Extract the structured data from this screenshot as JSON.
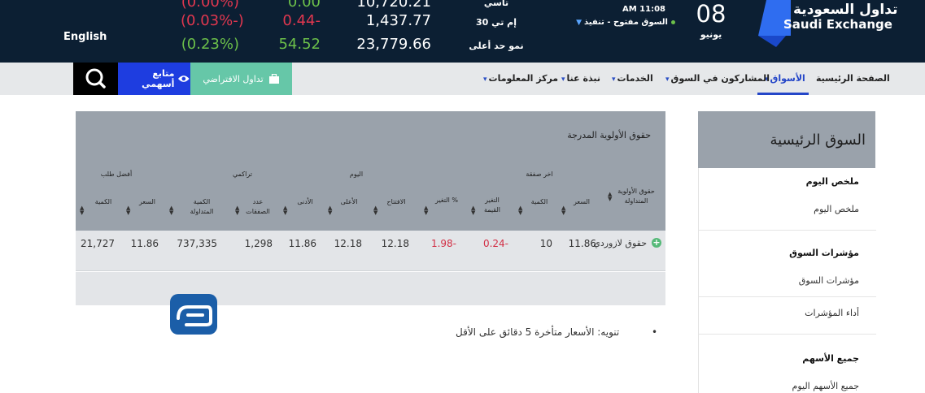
{
  "header": {
    "language_label": "English",
    "ticker": [
      {
        "pct": "(0.03%-)",
        "change": "0.44-",
        "value": "1,437.77",
        "label": "إم تي 30",
        "dir": "down"
      },
      {
        "pct": "(0.23%)",
        "change": "54.52",
        "value": "23,779.66",
        "label": "نمو حد أعلى",
        "dir": "up"
      }
    ],
    "status_time": "AM 11:08",
    "status_text": "السوق مفتوح - تنفيذ",
    "date_day": "08",
    "date_month": "يونيو",
    "logo_ar": "تداول السعودية",
    "logo_en": "Saudi Exchange"
  },
  "nav": {
    "items": [
      "الصفحة الرئيسية",
      "الأسواق",
      "المشاركون في السوق",
      "الخدمات",
      "نبذة عنا",
      "مركز المعلومات"
    ],
    "active_index": 1,
    "watchlist_label": "متابع أسهمي",
    "virtual_label": "تداول الافتراضي"
  },
  "main": {
    "title": "حقوق الأولوية المدرجة",
    "group_headers": {
      "last_trade": "اخر صفقة",
      "today": "اليوم",
      "cumulative": "تراكمي",
      "best_bid": "أفضل طلب"
    },
    "columns": {
      "name": "حقوق الأولوية المتداولة",
      "price": "السعر",
      "qty": "الكمية",
      "change_value": "التغير القيمة",
      "change_pct": "% التغير",
      "open": "الافتتاح",
      "high": "الأعلى",
      "low": "الأدنى",
      "trades": "عدد الصفقات",
      "traded_qty": "الكمية المتداولة",
      "bid_price": "السعر",
      "bid_qty": "الكمية"
    },
    "rows": [
      {
        "name": "حقوق لازوردي",
        "price": "11.86",
        "qty": "10",
        "change_value": "0.24-",
        "change_pct": "1.98-",
        "open": "12.18",
        "high": "12.18",
        "low": "11.86",
        "trades": "1,298",
        "traded_qty": "737,335",
        "bid_price": "11.86",
        "bid_qty": "21,727"
      }
    ],
    "note": "تنويه: الأسعار متأخرة 5 دقائق على الأقل"
  },
  "sidebar": {
    "title": "السوق الرئيسية",
    "groups": [
      {
        "heading": "ملخص اليوم",
        "items": [
          "ملخص اليوم"
        ]
      },
      {
        "heading": "مؤشرات السوق",
        "items": [
          "مؤشرات السوق",
          "أداء المؤشرات"
        ]
      },
      {
        "heading": "جميع الأسهم",
        "items": [
          "جميع الأسهم اليوم"
        ]
      }
    ]
  },
  "colors": {
    "header_bg": "#0c1f33",
    "positive": "#6cc04a",
    "negative": "#e0374f",
    "accent_blue": "#2446c8",
    "watch_button": "#1e3de0",
    "virtual_button": "#66c7a8",
    "table_header": "#9aa2ab"
  },
  "icons": {
    "search": "search-icon",
    "watch": "eye-icon",
    "virtual": "briefcase-icon",
    "expand": "plus-circle-icon"
  }
}
